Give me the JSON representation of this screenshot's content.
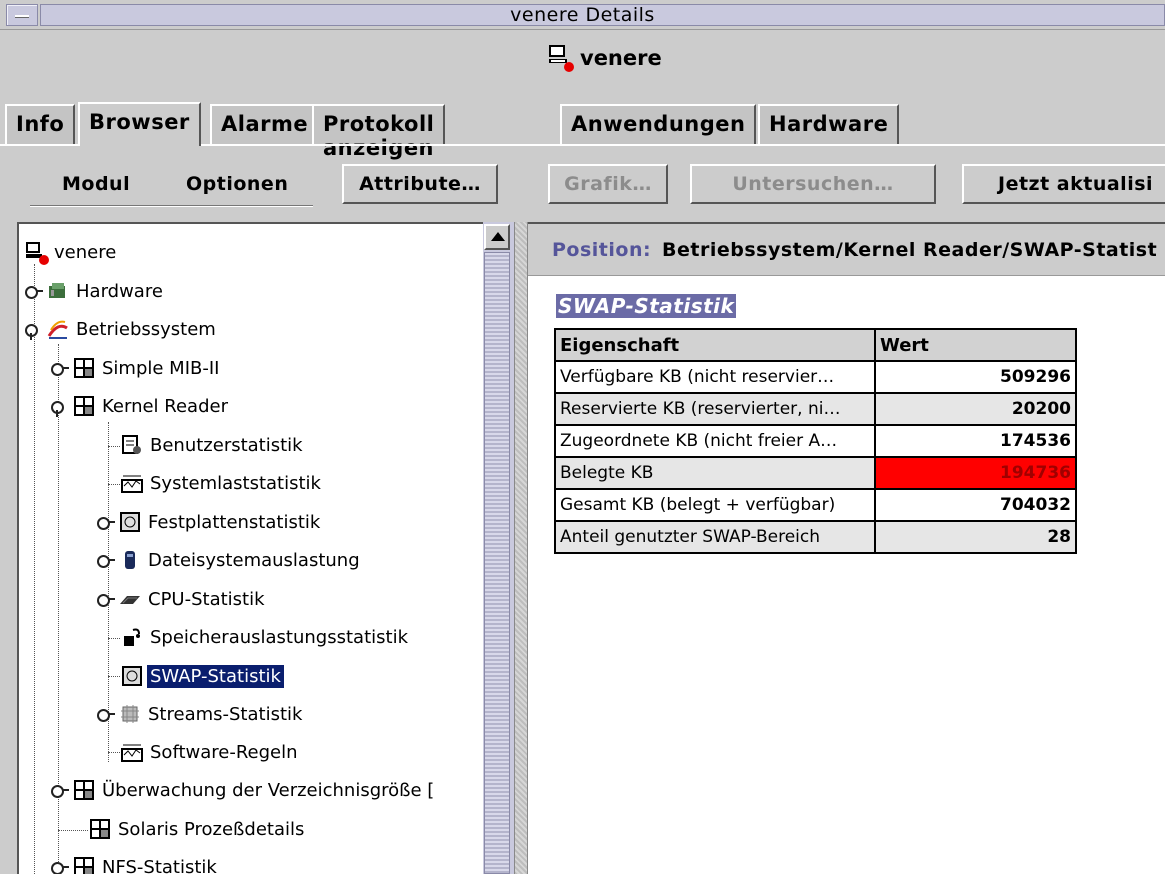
{
  "window": {
    "title": "venere Details",
    "host_label": "venere"
  },
  "tabs": [
    "Info",
    "Browser",
    "Alarme",
    "Protokoll anzeigen",
    "Anwendungen",
    "Hardware"
  ],
  "active_tab": "Browser",
  "toolbar": {
    "menu_modul": "Modul",
    "menu_optionen": "Optionen",
    "attribute": "Attribute…",
    "grafik": "Grafik…",
    "untersuchen": "Untersuchen…",
    "jetzt": "Jetzt aktualisi"
  },
  "tree": {
    "root": "venere",
    "hardware": "Hardware",
    "betriebssystem": "Betriebssystem",
    "simple_mib": "Simple MIB-II",
    "kernel_reader": "Kernel Reader",
    "benutzer": "Benutzerstatistik",
    "systemlast": "Systemlaststatistik",
    "festplatten": "Festplattenstatistik",
    "dateisystem": "Dateisystemauslastung",
    "cpu": "CPU-Statistik",
    "speicher": "Speicherauslastungsstatistik",
    "swap": "SWAP-Statistik",
    "streams": "Streams-Statistik",
    "software": "Software-Regeln",
    "ueberwachung": "Überwachung der Verzeichnisgröße [",
    "solaris": "Solaris Prozeßdetails",
    "nfs": "NFS-Statistik"
  },
  "position": {
    "label": "Position:",
    "path": "Betriebssystem/Kernel Reader/SWAP-Statist"
  },
  "section_title": "SWAP-Statistik",
  "table": {
    "headers": [
      "Eigenschaft",
      "Wert"
    ],
    "rows": [
      {
        "key": "Verfügbare KB (nicht reservier…",
        "value": "509296"
      },
      {
        "key": "Reservierte KB (reservierter, ni…",
        "value": "20200"
      },
      {
        "key": "Zugeordnete KB (nicht freier A…",
        "value": "174536"
      },
      {
        "key": "Belegte KB",
        "value": "194736"
      },
      {
        "key": "Gesamt KB (belegt + verfügbar)",
        "value": "704032"
      },
      {
        "key": "Anteil genutzter SWAP-Bereich",
        "value": "28"
      }
    ]
  },
  "colors": {
    "selection": "#0a1e6e",
    "alarm": "#ff0000",
    "section_title_bg": "#6b6ba6"
  }
}
